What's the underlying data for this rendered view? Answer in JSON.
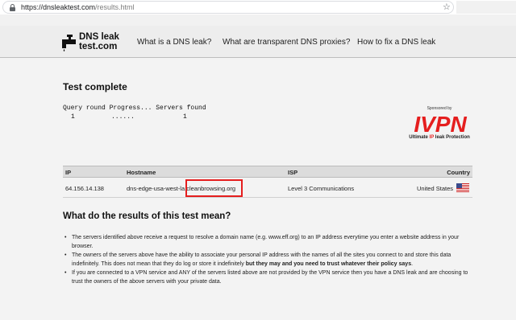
{
  "browser": {
    "url_domain": "https://dnsleaktest.com",
    "url_path": "/results.html"
  },
  "header": {
    "logo_line1": "DNS leak",
    "logo_line2": "test.com",
    "nav": [
      {
        "label": "What is a DNS leak?"
      },
      {
        "label": "What are transparent DNS proxies?"
      },
      {
        "label": "How to fix a DNS leak"
      }
    ]
  },
  "main": {
    "title": "Test complete",
    "progress_header": "Query round Progress... Servers found",
    "progress_round": "1",
    "progress_dots": "......",
    "progress_servers": "1"
  },
  "sponsor": {
    "label": "Sponsored by",
    "brand": "IVPN",
    "tagline_pre": "Ultimate ",
    "tagline_ip": "IP",
    "tagline_post": " leak Protection",
    "brand_color": "#e51e1e"
  },
  "results": {
    "columns": [
      "IP",
      "Hostname",
      "ISP",
      "Country"
    ],
    "rows": [
      {
        "ip": "64.156.14.138",
        "hostname_prefix": "dns-edge-usa-west-la.",
        "hostname_highlight": "cleanbrowsing.org",
        "isp": "Level 3 Communications",
        "country": "United States",
        "flag_icon": "us-flag-icon"
      }
    ],
    "highlight_color": "#e51e1e"
  },
  "explanation": {
    "title": "What do the results of this test mean?",
    "item1": "The servers identified above receive a request to resolve a domain name (e.g. www.eff.org) to an IP address everytime you enter a website address in your browser.",
    "item2_pre": "The owners of the servers above have the ability to associate your personal IP address with the names of all the sites you connect to and store this data indefinitely. This does not mean that they do log or store it indefinitely ",
    "item2_bold": "but they may and you need to trust whatever their policy says",
    "item2_post": ".",
    "item3": "If you are connected to a VPN service and ANY of the servers listed above are not provided by the VPN service then you have a DNS leak and are choosing to trust the owners of the above servers with your private data."
  }
}
